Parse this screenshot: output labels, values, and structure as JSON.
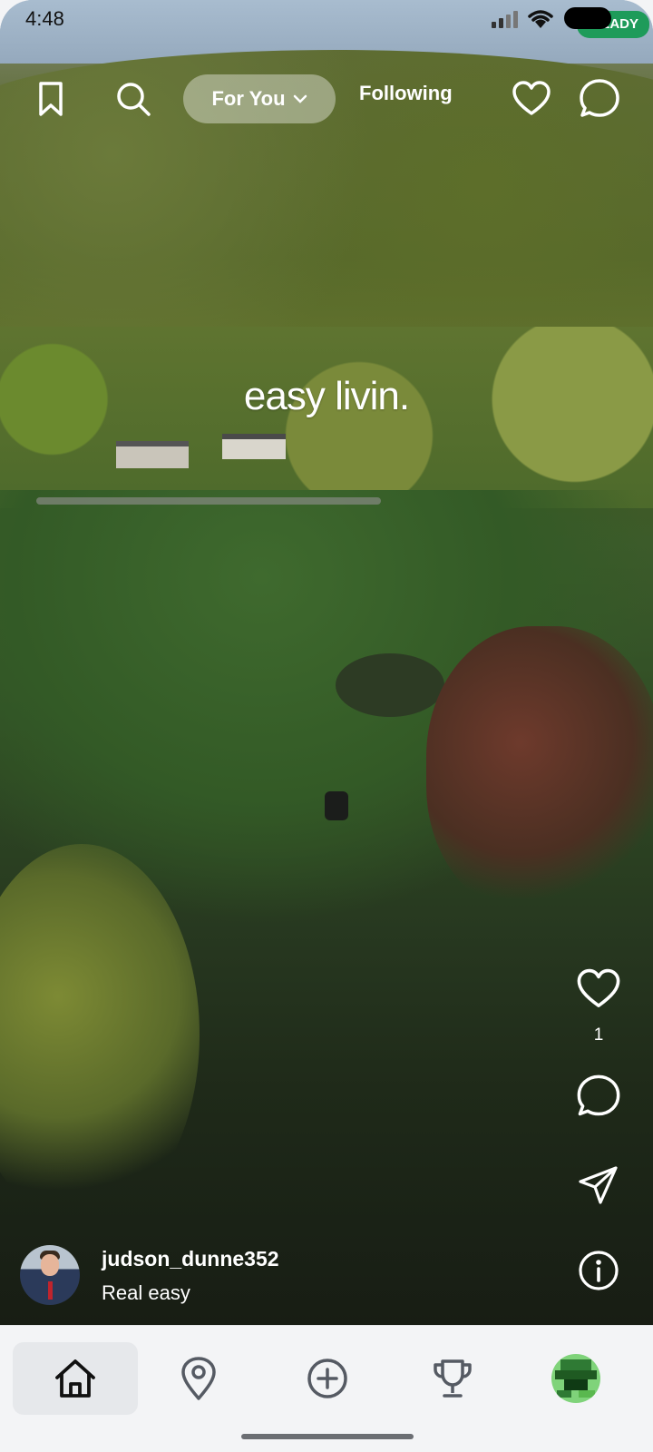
{
  "status_bar": {
    "time": "4:48",
    "badge": "READY",
    "badge_color": "#1e9b5a"
  },
  "top_bar": {
    "tab_for_you": "For You",
    "tab_following": "Following",
    "icons": [
      "bookmark-icon",
      "search-icon",
      "heart-icon",
      "chat-bubble-icon"
    ]
  },
  "video": {
    "overlay_text": "easy livin."
  },
  "actions": {
    "like_count": "1",
    "icons": [
      "heart-icon",
      "comment-icon",
      "share-icon",
      "info-icon"
    ]
  },
  "post": {
    "username": "judson_dunne352",
    "caption": "Real easy"
  },
  "bottom_nav": {
    "items": [
      {
        "icon": "home-icon",
        "selected": true
      },
      {
        "icon": "map-pin-icon",
        "selected": false
      },
      {
        "icon": "plus-circle-icon",
        "selected": false
      },
      {
        "icon": "trophy-icon",
        "selected": false
      },
      {
        "icon": "profile-avatar",
        "selected": false
      }
    ]
  }
}
